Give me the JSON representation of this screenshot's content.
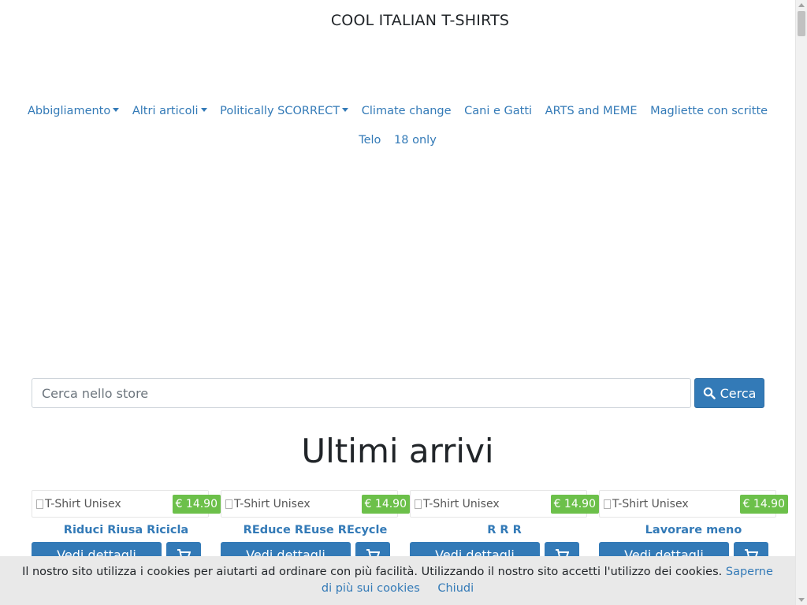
{
  "brand": "COOL ITALIAN T-SHIRTS",
  "nav": {
    "row1": [
      {
        "label": "Abbigliamento",
        "dropdown": true
      },
      {
        "label": "Altri articoli",
        "dropdown": true
      },
      {
        "label": "Politically SCORRECT",
        "dropdown": true
      },
      {
        "label": "Climate change",
        "dropdown": false
      },
      {
        "label": "Cani e Gatti",
        "dropdown": false
      },
      {
        "label": "ARTS and MEME",
        "dropdown": false
      },
      {
        "label": "Magliette con scritte",
        "dropdown": false
      }
    ],
    "row2": [
      {
        "label": "Telo",
        "dropdown": false
      },
      {
        "label": "18 only",
        "dropdown": false
      }
    ]
  },
  "search": {
    "placeholder": "Cerca nello store",
    "value": "",
    "button_label": "Cerca",
    "button_icon": "search-icon"
  },
  "section_title": "Ultimi arrivi",
  "products": [
    {
      "image_alt": "T-Shirt Unisex",
      "price": "€ 14.90",
      "title": "Riduci Riusa Ricicla",
      "details_label": "Vedi dettagli"
    },
    {
      "image_alt": "T-Shirt Unisex",
      "price": "€ 14.90",
      "title": "REduce REuse REcycle",
      "details_label": "Vedi dettagli"
    },
    {
      "image_alt": "T-Shirt Unisex",
      "price": "€ 14.90",
      "title": "R R R",
      "details_label": "Vedi dettagli"
    },
    {
      "image_alt": "T-Shirt Unisex",
      "price": "€ 14.90",
      "title": "Lavorare meno",
      "details_label": "Vedi dettagli"
    }
  ],
  "cookie_bar": {
    "text": "Il nostro sito utilizza i cookies per aiutarti ad ordinare con più facilità. Utilizzando il nostro sito accetti l'utilizzo dei cookies.",
    "more_link": "Saperne di più sui cookies",
    "close_link": "Chiudi"
  },
  "colors": {
    "link": "#337ab7",
    "primary_button": "#337ab7",
    "price_badge": "#6cc04a",
    "cookie_bar_bg": "#e9e9e9"
  }
}
